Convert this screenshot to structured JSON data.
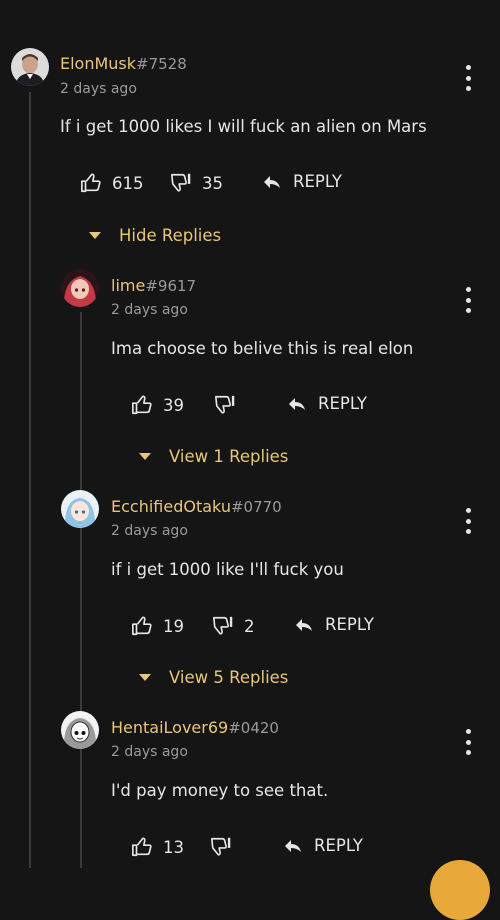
{
  "comments": [
    {
      "username": "ElonMusk",
      "tag": "#7528",
      "time": "2 days ago",
      "text": "If i get 1000 likes I will fuck an alien on Mars",
      "likes": "615",
      "dislikes": "35",
      "reply_label": "REPLY",
      "toggle_label": "Hide Replies",
      "avatar_icon": "avatar-portrait"
    },
    {
      "username": "lime",
      "tag": "#9617",
      "time": "2 days ago",
      "text": "Ima choose to belive this is real elon",
      "likes": "39",
      "dislikes": "",
      "reply_label": "REPLY",
      "toggle_label": "View 1 Replies",
      "avatar_icon": "avatar-anime-red"
    },
    {
      "username": "EcchifiedOtaku",
      "tag": "#0770",
      "time": "2 days ago",
      "text": "if i get 1000 like I'll fuck you",
      "likes": "19",
      "dislikes": "2",
      "reply_label": "REPLY",
      "toggle_label": "View 5 Replies",
      "avatar_icon": "avatar-anime-blue"
    },
    {
      "username": "HentaiLover69",
      "tag": "#0420",
      "time": "2 days ago",
      "text": "I'd pay money to see that.",
      "likes": "13",
      "dislikes": "",
      "reply_label": "REPLY",
      "avatar_icon": "avatar-manga"
    }
  ],
  "colors": {
    "background": "#151515",
    "username": "#e8c77b",
    "tag": "#9a9a9a",
    "text": "#e6e6e6",
    "thread_line": "#3a3a3a"
  }
}
